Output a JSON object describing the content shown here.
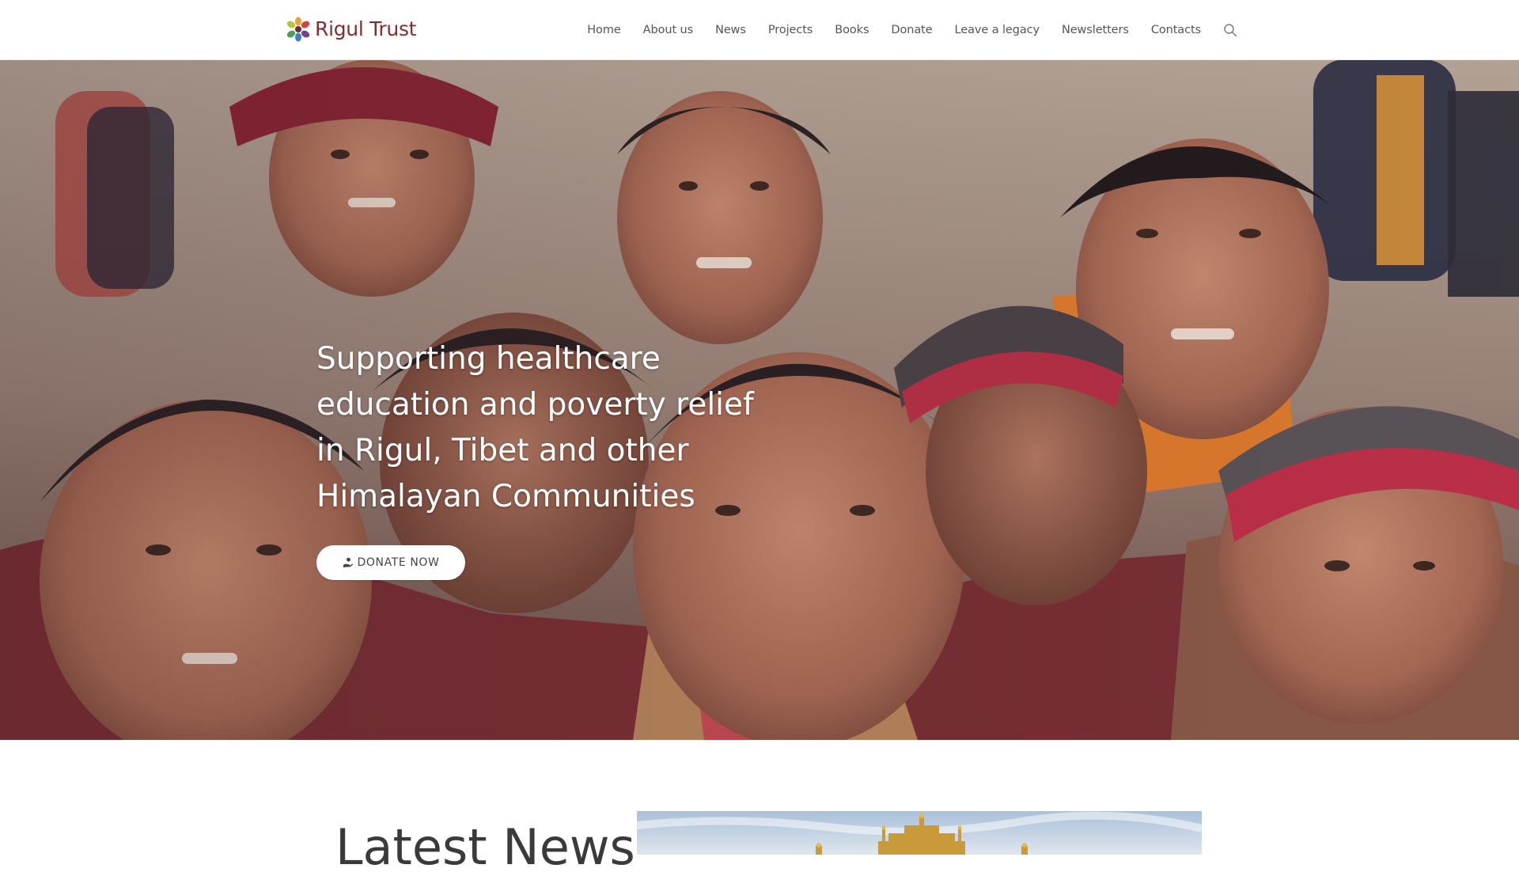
{
  "header": {
    "logo_text": "Rigul Trust",
    "nav": [
      {
        "label": "Home"
      },
      {
        "label": "About us"
      },
      {
        "label": "News"
      },
      {
        "label": "Projects"
      },
      {
        "label": "Books"
      },
      {
        "label": "Donate"
      },
      {
        "label": "Leave a legacy"
      },
      {
        "label": "Newsletters"
      },
      {
        "label": "Contacts"
      }
    ],
    "search_icon": "search-icon"
  },
  "hero": {
    "heading": "Supporting healthcare education and poverty relief in Rigul, Tibet and other Himalayan Communities",
    "button_label": "DONATE NOW",
    "button_icon": "donate-hand-icon"
  },
  "news": {
    "title": "Latest News"
  },
  "colors": {
    "brand": "#8a2a2b",
    "nav_text": "#555555",
    "hero_text": "#ffffff",
    "button_bg": "#ffffff"
  }
}
